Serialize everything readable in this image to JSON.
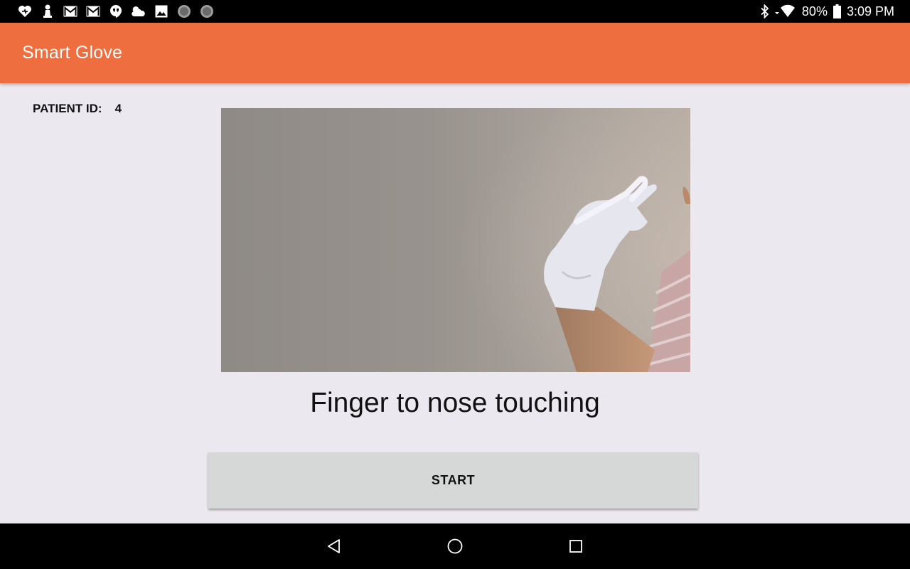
{
  "status_bar": {
    "notification_icons": [
      "heart-icon",
      "chess-pawn-icon",
      "gmail-icon",
      "gmail-icon",
      "hangouts-icon",
      "weather-icon",
      "image-icon",
      "dot-icon",
      "dot-icon"
    ],
    "battery_percent": "80%",
    "time": "3:09 PM"
  },
  "app_bar": {
    "title": "Smart Glove",
    "color": "#ef6e3f"
  },
  "patient": {
    "label": "PATIENT ID:",
    "value": "4"
  },
  "exercise": {
    "label": "Finger to nose touching"
  },
  "start_button": {
    "label": "START"
  },
  "colors": {
    "background": "#ece8ef",
    "button": "#d6d7d7"
  }
}
